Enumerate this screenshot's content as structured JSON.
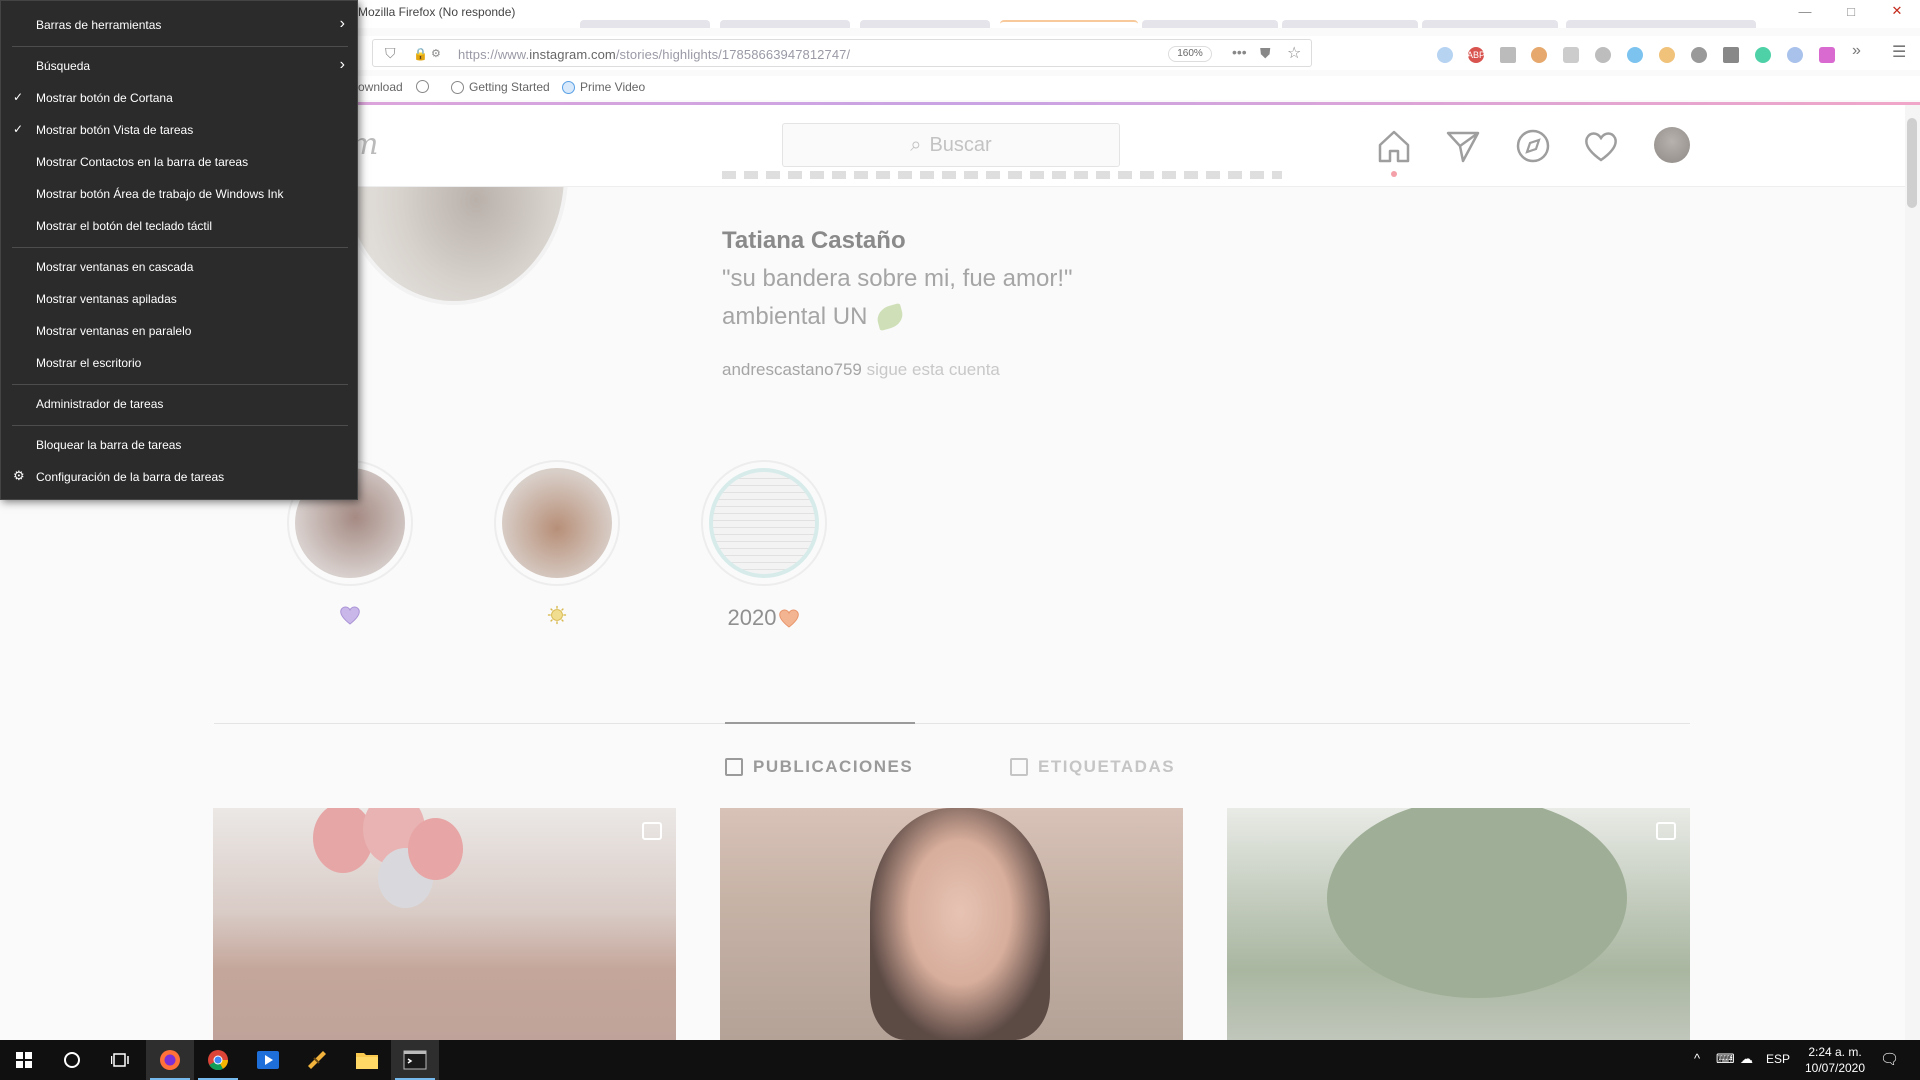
{
  "window": {
    "title": "Mozilla Firefox (No responde)"
  },
  "navbar": {
    "url_prefix": "https://www.",
    "url_host": "instagram.com",
    "url_path": "/stories/highlights/17858663947812747/",
    "zoom": "160%"
  },
  "bookmarks": {
    "partial_item": "ownload",
    "getting_started": "Getting Started",
    "prime_video": "Prime Video"
  },
  "instagram": {
    "logo_partial": "m",
    "search_placeholder": "Buscar",
    "profile": {
      "full_name": "Tatiana Castaño",
      "bio_line1": "\"su bandera sobre mi, fue amor!\"",
      "bio_line2": "ambiental UN",
      "followed_by_user": "andrescastano759",
      "followed_by_suffix": "sigue esta cuenta"
    },
    "highlights": [
      {
        "label": ""
      },
      {
        "label": ""
      },
      {
        "label": "2020"
      }
    ],
    "tabs": {
      "posts": "PUBLICACIONES",
      "tagged": "ETIQUETADAS"
    }
  },
  "context_menu": {
    "items": [
      {
        "label": "Barras de herramientas",
        "checked": false,
        "submenu": true
      },
      {
        "label": "Búsqueda",
        "checked": false,
        "submenu": true
      },
      {
        "label": "Mostrar botón de Cortana",
        "checked": true,
        "submenu": false
      },
      {
        "label": "Mostrar botón Vista de tareas",
        "checked": true,
        "submenu": false
      },
      {
        "label": "Mostrar Contactos en la barra de tareas",
        "checked": false,
        "submenu": false
      },
      {
        "label": "Mostrar botón Área de trabajo de Windows Ink",
        "checked": false,
        "submenu": false
      },
      {
        "label": "Mostrar el botón del teclado táctil",
        "checked": false,
        "submenu": false
      },
      {
        "label": "Mostrar ventanas en cascada",
        "checked": false,
        "submenu": false
      },
      {
        "label": "Mostrar ventanas apiladas",
        "checked": false,
        "submenu": false
      },
      {
        "label": "Mostrar ventanas en paralelo",
        "checked": false,
        "submenu": false
      },
      {
        "label": "Mostrar el escritorio",
        "checked": false,
        "submenu": false
      },
      {
        "label": "Administrador de tareas",
        "checked": false,
        "submenu": false
      },
      {
        "label": "Bloquear la barra de tareas",
        "checked": false,
        "submenu": false
      },
      {
        "label": "Configuración de la barra de tareas",
        "checked": false,
        "submenu": false,
        "icon": "gear-icon"
      }
    ]
  },
  "taskbar": {
    "language": "ESP",
    "time": "2:24 a. m.",
    "date": "10/07/2020"
  },
  "colors": {
    "menu_bg": "#2b2b2b",
    "taskbar_bg": "#101010",
    "accent": "#76b9ed",
    "load_bar": "#d6a6d8"
  }
}
